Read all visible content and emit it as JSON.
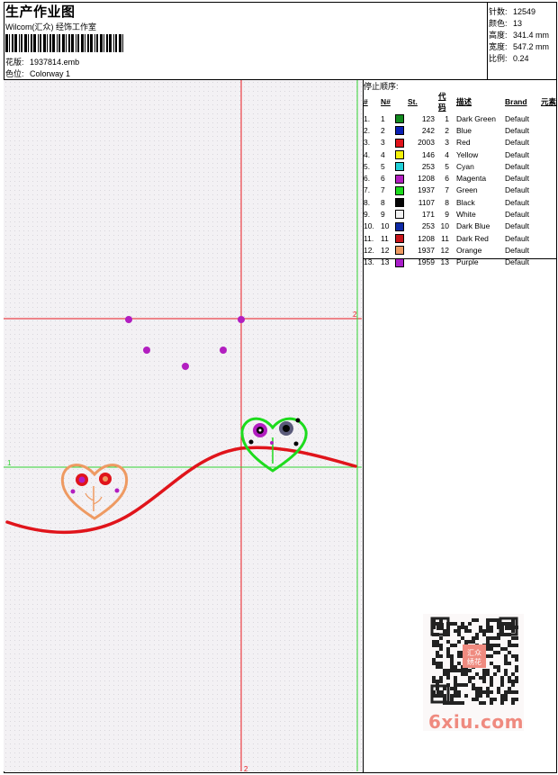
{
  "header": {
    "title": "生产作业图",
    "company": "Wilcom(汇众) 经饰工作室",
    "design_label": "花版:",
    "design_value": "1937814.emb",
    "colorway_label": "色位:",
    "colorway_value": "Colorway 1"
  },
  "stats": [
    {
      "label": "针数:",
      "value": "12549"
    },
    {
      "label": "颜色:",
      "value": "13"
    },
    {
      "label": "高度:",
      "value": "341.4 mm"
    },
    {
      "label": "宽度:",
      "value": "547.2 mm"
    },
    {
      "label": "比例:",
      "value": "0.24"
    }
  ],
  "guides": {
    "top_mark": "2",
    "left_mark": "1",
    "bottom_mark": "2"
  },
  "table": {
    "title": "停止顺序:",
    "headers": [
      "#",
      "N#",
      "St.",
      "代码",
      "描述",
      "Brand",
      "元素"
    ],
    "rows": [
      {
        "idx": "1.",
        "n": "1",
        "color": "#118a1e",
        "st": "123",
        "code": "1",
        "desc": "Dark Green",
        "brand": "Default"
      },
      {
        "idx": "2.",
        "n": "2",
        "color": "#0a1fb3",
        "st": "242",
        "code": "2",
        "desc": "Blue",
        "brand": "Default"
      },
      {
        "idx": "3.",
        "n": "3",
        "color": "#e0141b",
        "st": "2003",
        "code": "3",
        "desc": "Red",
        "brand": "Default"
      },
      {
        "idx": "4.",
        "n": "4",
        "color": "#f5f20a",
        "st": "146",
        "code": "4",
        "desc": "Yellow",
        "brand": "Default"
      },
      {
        "idx": "5.",
        "n": "5",
        "color": "#21d0d8",
        "st": "253",
        "code": "5",
        "desc": "Cyan",
        "brand": "Default"
      },
      {
        "idx": "6.",
        "n": "6",
        "color": "#b21ec0",
        "st": "1208",
        "code": "6",
        "desc": "Magenta",
        "brand": "Default"
      },
      {
        "idx": "7.",
        "n": "7",
        "color": "#1ddb1d",
        "st": "1937",
        "code": "7",
        "desc": "Green",
        "brand": "Default"
      },
      {
        "idx": "8.",
        "n": "8",
        "color": "#050505",
        "st": "1107",
        "code": "8",
        "desc": "Black",
        "brand": "Default"
      },
      {
        "idx": "9.",
        "n": "9",
        "color": "#f2f2f2",
        "st": "171",
        "code": "9",
        "desc": "White",
        "brand": "Default"
      },
      {
        "idx": "10.",
        "n": "10",
        "color": "#0e2aa6",
        "st": "253",
        "code": "10",
        "desc": "Dark Blue",
        "brand": "Default"
      },
      {
        "idx": "11.",
        "n": "11",
        "color": "#c8141a",
        "st": "1208",
        "code": "11",
        "desc": "Dark Red",
        "brand": "Default"
      },
      {
        "idx": "12.",
        "n": "12",
        "color": "#ee9a62",
        "st": "1937",
        "code": "12",
        "desc": "Orange",
        "brand": "Default"
      },
      {
        "idx": "13.",
        "n": "13",
        "color": "#a91ec9",
        "st": "1959",
        "code": "13",
        "desc": "Purple",
        "brand": "Default"
      }
    ]
  },
  "watermark": {
    "site": "6xiu.com",
    "seal": "汇众绣花"
  },
  "colors": {
    "guide_red": "#e8191f",
    "guide_green": "#32d232",
    "curve": "#e0141b",
    "heart_orange": "#ee9a62",
    "heart_green": "#1ddb1d",
    "flower_purple": "#b21ec0"
  }
}
